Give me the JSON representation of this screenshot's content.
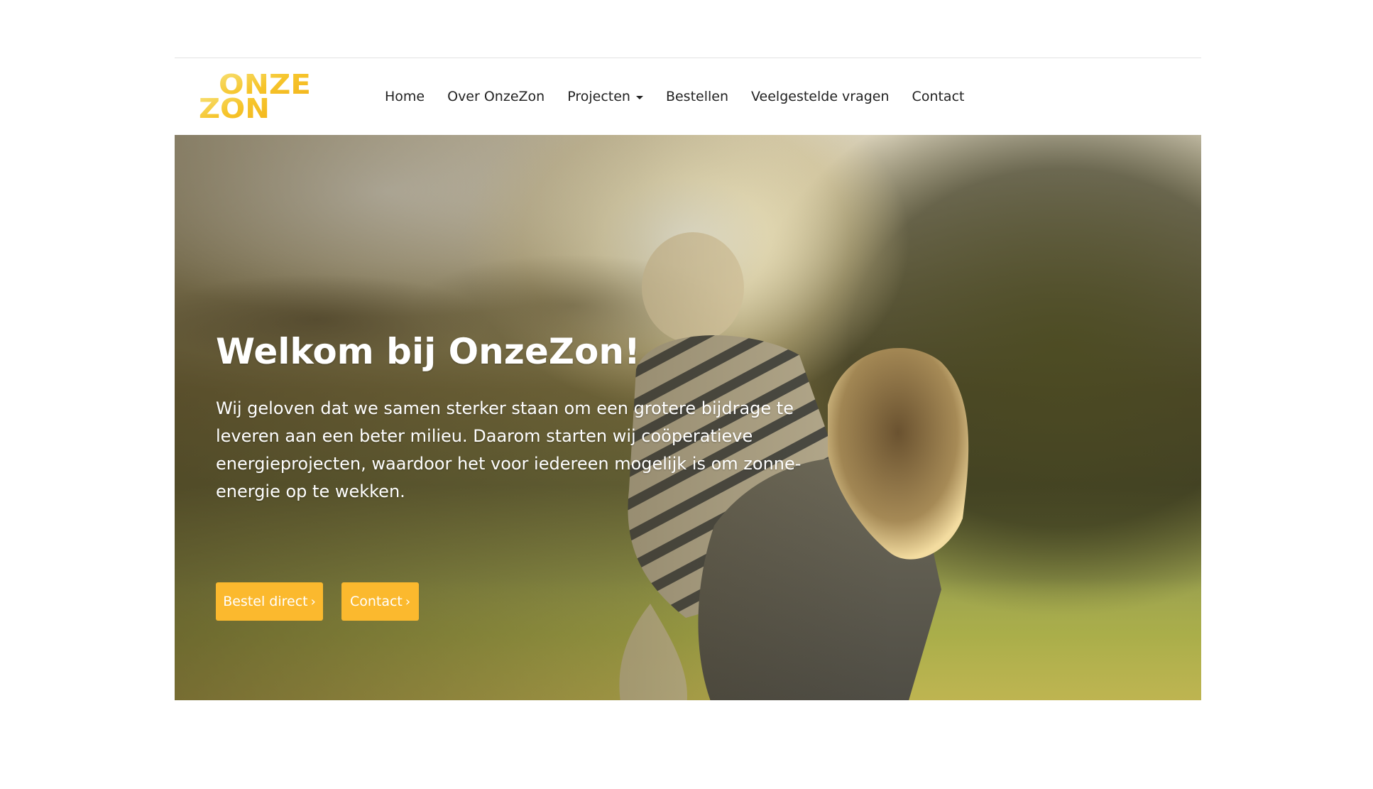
{
  "brand": {
    "logo_line1": "ONZE",
    "logo_line2": "ZON",
    "accent_color": "#fbb92e"
  },
  "nav": {
    "items": [
      {
        "label": "Home"
      },
      {
        "label": "Over OnzeZon"
      },
      {
        "label": "Projecten",
        "has_dropdown": true
      },
      {
        "label": "Bestellen"
      },
      {
        "label": "Veelgestelde vragen"
      },
      {
        "label": "Contact"
      }
    ]
  },
  "hero": {
    "title": "Welkom bij OnzeZon!",
    "text": "Wij geloven dat we samen sterker staan om een grotere bijdrage te leveren aan een beter milieu. Daarom starten wij coöperatieve energieprojecten, waardoor het voor iedereen mogelijk is om zonne-energie op te wekken.",
    "buttons": {
      "order_label": "Bestel direct",
      "contact_label": "Contact"
    },
    "icons": {
      "button_chevron": "chevron-right-icon",
      "dropdown_caret": "caret-down-icon"
    }
  }
}
